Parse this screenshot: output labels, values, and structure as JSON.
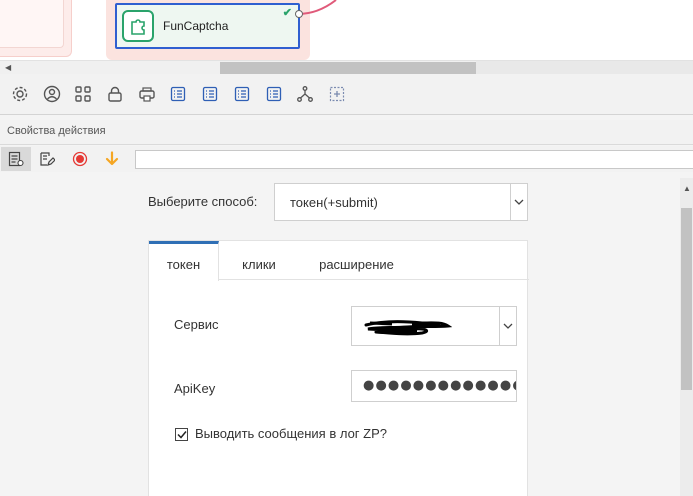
{
  "canvas": {
    "node": {
      "title": "FunCaptcha",
      "status_icon": "check-icon",
      "icon": "puzzle-icon"
    }
  },
  "toolbar": {
    "icons": [
      "gear-icon",
      "user-circle-icon",
      "grid-icon",
      "lock-icon",
      "print-icon",
      "list-icon",
      "list-icon",
      "list-icon",
      "list-icon",
      "branch-icon",
      "add-box-icon"
    ]
  },
  "properties": {
    "title": "Свойства действия",
    "toolbar_icons": [
      "properties-icon",
      "edit-icon",
      "record-icon",
      "arrow-down-icon"
    ],
    "search_value": ""
  },
  "form": {
    "method_label": "Выберите способ:",
    "method_value": "токен(+submit)",
    "tabs": [
      {
        "label": "токен",
        "active": true
      },
      {
        "label": "клики",
        "active": false
      },
      {
        "label": "расширение",
        "active": false
      }
    ],
    "service_label": "Сервис",
    "apikey_label": "ApiKey",
    "apikey_value": "●●●●●●●●●●●●●●●●●●",
    "log_checkbox_label": "Выводить сообщения в лог ZP?",
    "log_checkbox_checked": true
  },
  "colors": {
    "node_border": "#2f5fd0",
    "node_accent": "#2aa36b",
    "tab_active": "#2f6fb5",
    "record": "#e53935",
    "arrow_down": "#f5a623",
    "connector": "#e05a7a"
  }
}
